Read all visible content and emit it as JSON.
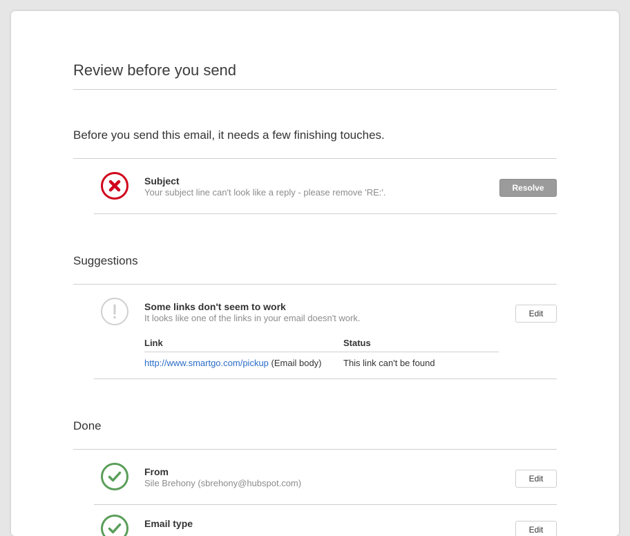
{
  "page": {
    "title": "Review before you send",
    "intro": "Before you send this email, it needs a few finishing touches."
  },
  "errors": {
    "items": [
      {
        "icon": "error-x-icon",
        "title": "Subject",
        "description": "Your subject line can't look like a reply - please remove 'RE:'.",
        "button": "Resolve"
      }
    ]
  },
  "suggestions": {
    "title": "Suggestions",
    "items": [
      {
        "icon": "warning-exclamation-icon",
        "title": "Some links don't seem to work",
        "description": "It looks like one of the links in your email doesn't work.",
        "button": "Edit",
        "table": {
          "headers": [
            "Link",
            "Status"
          ],
          "rows": [
            {
              "url": "http://www.smartgo.com/pickup",
              "location": "(Email body)",
              "status": "This link can't be found"
            }
          ]
        }
      }
    ]
  },
  "done": {
    "title": "Done",
    "items": [
      {
        "icon": "checkmark-icon",
        "title": "From",
        "description": "Sile Brehony (sbrehony@hubspot.com)",
        "button": "Edit"
      },
      {
        "icon": "checkmark-icon",
        "title": "Email type",
        "button": "Edit"
      }
    ]
  },
  "colors": {
    "error": "#d0021b",
    "success": "#5a9e59",
    "link": "#2a6cc8",
    "resolve_button": "#9b9b9b"
  }
}
